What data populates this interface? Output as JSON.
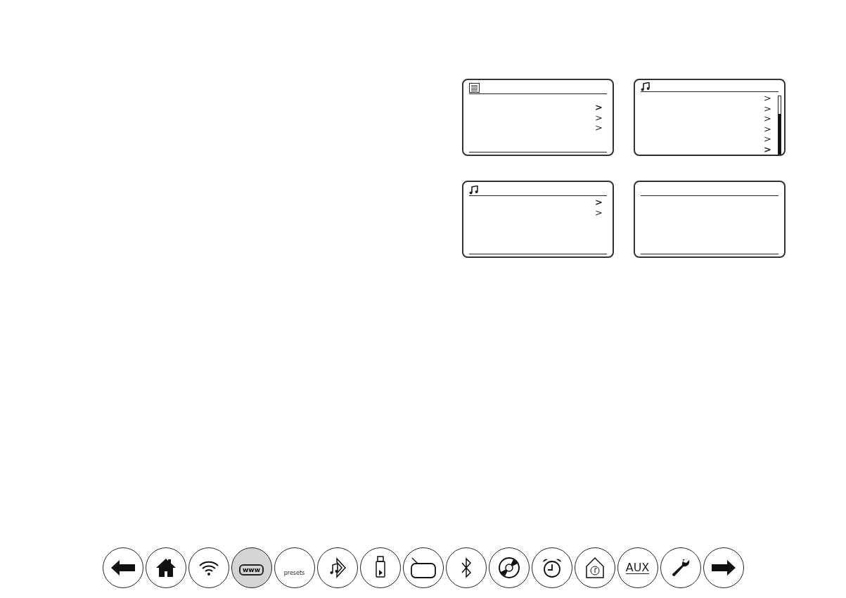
{
  "screens": [
    {
      "kind": "menu",
      "scrollbar": false,
      "rows": [
        {
          "text": ">",
          "selected": true
        },
        {
          "text": ">",
          "selected": false
        },
        {
          "text": ">",
          "selected": false
        }
      ]
    },
    {
      "kind": "music",
      "scrollbar": true,
      "rows": [
        {
          "text": ">",
          "selected": false
        },
        {
          "text": ">",
          "selected": false
        },
        {
          "text": ">",
          "selected": false
        },
        {
          "text": ">",
          "selected": false
        },
        {
          "text": ">",
          "selected": false
        },
        {
          "text": ">",
          "selected": true
        }
      ]
    },
    {
      "kind": "music",
      "scrollbar": false,
      "rows": [
        {
          "text": ">",
          "selected": true
        },
        {
          "text": ">",
          "selected": false
        }
      ]
    },
    {
      "kind": "plain",
      "scrollbar": false
    }
  ],
  "nav": [
    {
      "kind": "back",
      "selected": false
    },
    {
      "kind": "home",
      "selected": false
    },
    {
      "kind": "wifi",
      "selected": false
    },
    {
      "kind": "internet-radio",
      "label": "www",
      "selected": true
    },
    {
      "kind": "presets",
      "label": "presets",
      "selected": false
    },
    {
      "kind": "music-player",
      "selected": false
    },
    {
      "kind": "usb",
      "selected": false
    },
    {
      "kind": "radio",
      "selected": false
    },
    {
      "kind": "bluetooth",
      "selected": false
    },
    {
      "kind": "cd",
      "selected": false
    },
    {
      "kind": "alarm",
      "selected": false
    },
    {
      "kind": "home-music",
      "selected": false
    },
    {
      "kind": "aux",
      "label": "AUX",
      "selected": false
    },
    {
      "kind": "settings",
      "selected": false
    },
    {
      "kind": "forward",
      "selected": false
    }
  ]
}
